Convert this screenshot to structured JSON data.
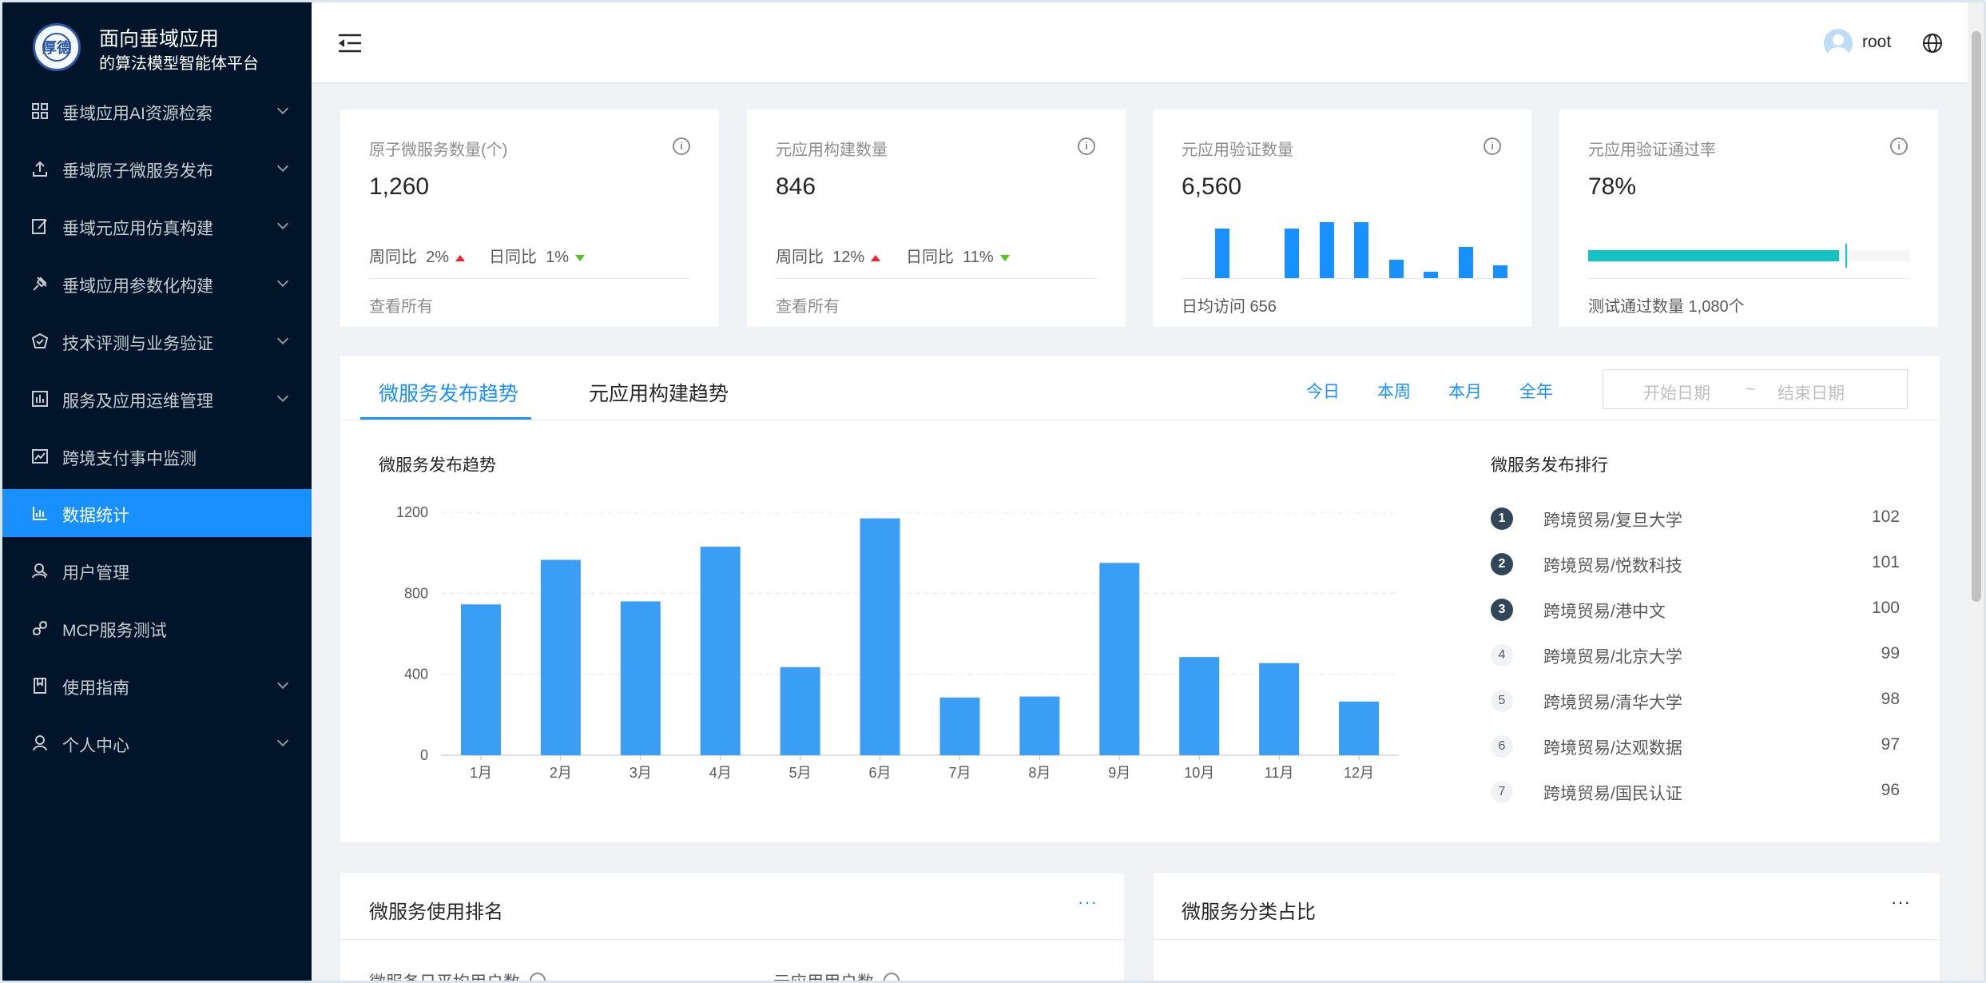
{
  "sidebar": {
    "logo_emblem_text": "厚德",
    "title_line1": "面向垂域应用",
    "title_line2": "的算法模型智能体平台",
    "items": [
      {
        "label": "垂域应用AI资源检索",
        "icon": "appstore-icon",
        "has_arrow": true,
        "active": false
      },
      {
        "label": "垂域原子微服务发布",
        "icon": "upload-icon",
        "has_arrow": true,
        "active": false
      },
      {
        "label": "垂域元应用仿真构建",
        "icon": "edit-icon",
        "has_arrow": true,
        "active": false
      },
      {
        "label": "垂域应用参数化构建",
        "icon": "pushpin-icon",
        "has_arrow": true,
        "active": false
      },
      {
        "label": "技术评测与业务验证",
        "icon": "safety-icon",
        "has_arrow": true,
        "active": false
      },
      {
        "label": "服务及应用运维管理",
        "icon": "fund-icon",
        "has_arrow": true,
        "active": false
      },
      {
        "label": "跨境支付事中监测",
        "icon": "line-chart-icon",
        "has_arrow": false,
        "active": false
      },
      {
        "label": "数据统计",
        "icon": "bar-chart-icon",
        "has_arrow": false,
        "active": true
      },
      {
        "label": "用户管理",
        "icon": "user-manage-icon",
        "has_arrow": false,
        "active": false
      },
      {
        "label": "MCP服务测试",
        "icon": "api-icon",
        "has_arrow": false,
        "active": false
      },
      {
        "label": "使用指南",
        "icon": "book-icon",
        "has_arrow": true,
        "active": false
      },
      {
        "label": "个人中心",
        "icon": "user-icon",
        "has_arrow": true,
        "active": false
      }
    ]
  },
  "header": {
    "username": "root"
  },
  "stats": [
    {
      "label": "原子微服务数量(个)",
      "value": "1,260",
      "week_label": "周同比",
      "week_value": "2%",
      "day_label": "日同比",
      "day_value": "1%",
      "footer": "查看所有"
    },
    {
      "label": "元应用构建数量",
      "value": "846",
      "week_label": "周同比",
      "week_value": "12%",
      "day_label": "日同比",
      "day_value": "11%",
      "footer": "查看所有"
    },
    {
      "label": "元应用验证数量",
      "value": "6,560",
      "footer": "日均访问 656",
      "mini_bars": [
        8,
        0,
        8,
        9,
        9,
        3,
        1,
        5,
        2
      ]
    },
    {
      "label": "元应用验证通过率",
      "value": "78%",
      "footer": "测试通过数量 1,080个",
      "progress": 0.78,
      "target": 0.8
    }
  ],
  "trend": {
    "tabs": [
      "微服务发布趋势",
      "元应用构建趋势"
    ],
    "ranges": [
      "今日",
      "本周",
      "本月",
      "全年"
    ],
    "date_start_placeholder": "开始日期",
    "date_sep": "~",
    "date_end_placeholder": "结束日期",
    "chart_title": "微服务发布趋势",
    "ranking_title": "微服务发布排行",
    "ranking": [
      {
        "rank": "1",
        "name": "跨境贸易/复旦大学",
        "value": "102"
      },
      {
        "rank": "2",
        "name": "跨境贸易/悦数科技",
        "value": "101"
      },
      {
        "rank": "3",
        "name": "跨境贸易/港中文",
        "value": "100"
      },
      {
        "rank": "4",
        "name": "跨境贸易/北京大学",
        "value": "99"
      },
      {
        "rank": "5",
        "name": "跨境贸易/清华大学",
        "value": "98"
      },
      {
        "rank": "6",
        "name": "跨境贸易/达观数据",
        "value": "97"
      },
      {
        "rank": "7",
        "name": "跨境贸易/国民认证",
        "value": "96"
      }
    ]
  },
  "chart_data": {
    "type": "bar",
    "title": "微服务发布趋势",
    "categories": [
      "1月",
      "2月",
      "3月",
      "4月",
      "5月",
      "6月",
      "7月",
      "8月",
      "9月",
      "10月",
      "11月",
      "12月"
    ],
    "values": [
      745,
      965,
      760,
      1030,
      435,
      1170,
      285,
      290,
      950,
      485,
      455,
      265
    ],
    "y_ticks": [
      "0",
      "400",
      "800",
      "1200"
    ],
    "ylim": [
      0,
      1200
    ],
    "grid": true,
    "color": "#3a9ef5"
  },
  "bottom": {
    "left_title": "微服务使用排名",
    "left_sub1": "微服务日平均用户数",
    "left_sub2": "元应用用户数",
    "right_title": "微服务分类占比",
    "more": "···"
  },
  "colors": {
    "sidebar_bg": "#001529",
    "accent": "#1890ff",
    "progress": "#13c2c2",
    "up": "#f5222d",
    "down": "#52c41a"
  }
}
